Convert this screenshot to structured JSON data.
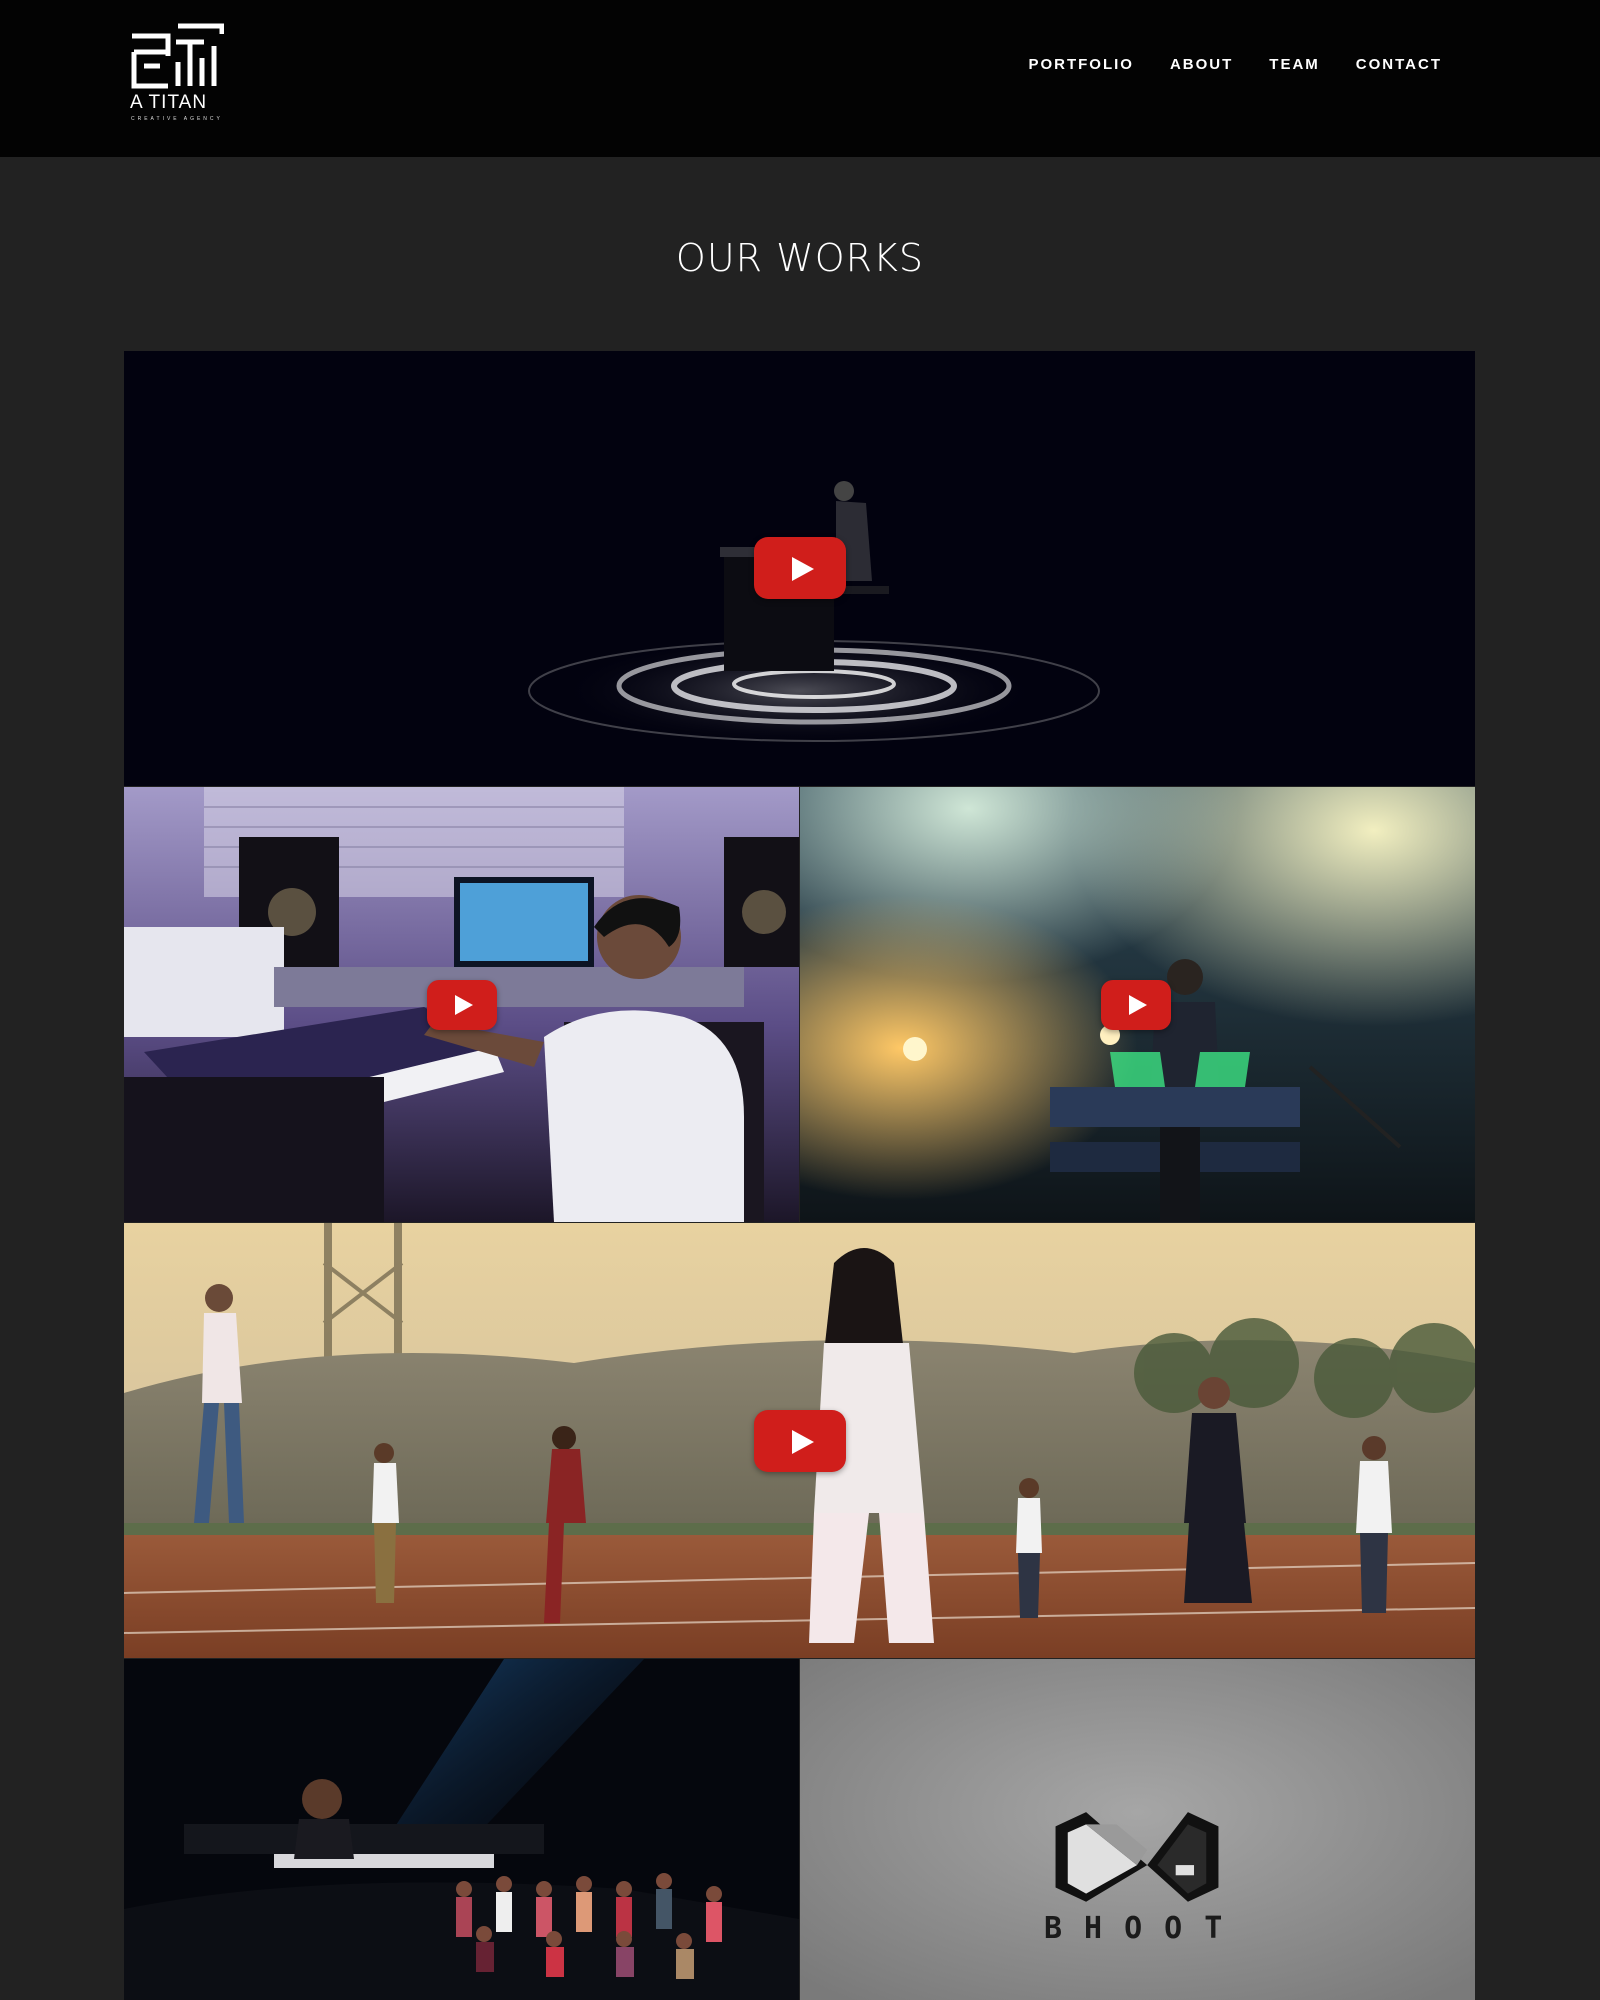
{
  "brand": {
    "name": "A TITAN",
    "tagline": "CREATIVE AGENCY"
  },
  "nav": {
    "items": [
      {
        "label": "PORTFOLIO"
      },
      {
        "label": "ABOUT"
      },
      {
        "label": "TEAM"
      },
      {
        "label": "CONTACT"
      }
    ]
  },
  "main": {
    "title": "OUR WORKS"
  },
  "works": {
    "bhoot_wordmark": "BHOOT"
  },
  "colors": {
    "header_bg": "#030303",
    "page_bg": "#222222",
    "play_button": "#d01e1b"
  }
}
